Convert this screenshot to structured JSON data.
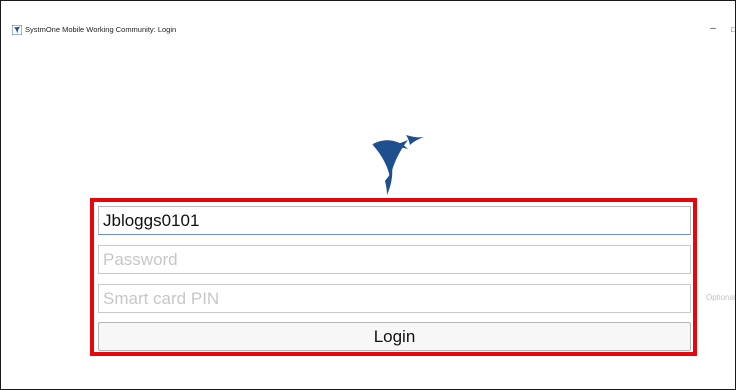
{
  "window": {
    "title": "SystmOne Mobile Working Community: Login",
    "minimize_glyph": "–",
    "maximize_glyph": "□",
    "icon": "systmone-app-icon"
  },
  "logo": {
    "icon": "systmone-bird-logo",
    "color": "#1e4f8f"
  },
  "form": {
    "username": {
      "value": "Jbloggs0101",
      "placeholder": ""
    },
    "password": {
      "value": "",
      "placeholder": "Password"
    },
    "smart_card_pin": {
      "value": "",
      "placeholder": "Smart card PIN",
      "hint": "Optional"
    },
    "login_label": "Login"
  },
  "colors": {
    "highlight_border": "#e8060c",
    "focus_underline": "#6a8fc7",
    "brand_blue": "#1e4f8f"
  }
}
